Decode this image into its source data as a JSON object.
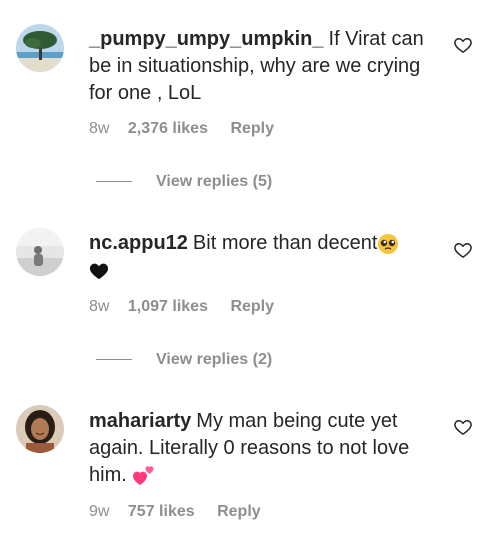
{
  "comments": [
    {
      "username": "_pumpy_umpy_umpkin_",
      "text": "If Virat can be in situationship, why are we crying for one , LoL",
      "time": "8w",
      "likes": "2,376 likes",
      "reply": "Reply",
      "view_replies": "View replies (5)",
      "avatar": "tree-on-beach-avatar"
    },
    {
      "username": "nc.appu12",
      "text": "Bit more than decent",
      "emojis": [
        "pleading-face-emoji",
        "black-heart-emoji"
      ],
      "time": "8w",
      "likes": "1,097 likes",
      "reply": "Reply",
      "view_replies": "View replies (2)",
      "avatar": "grayscale-person-avatar"
    },
    {
      "username": "mahariarty",
      "text": "My man being cute yet again. Literally 0 reasons to not love him.",
      "emojis": [
        "two-hearts-emoji"
      ],
      "time": "9w",
      "likes": "757 likes",
      "reply": "Reply",
      "avatar": "woman-portrait-avatar"
    }
  ],
  "colors": {
    "text": "#262626",
    "secondary": "#8e8e8e",
    "heart_pink": "#ff3b7b"
  }
}
